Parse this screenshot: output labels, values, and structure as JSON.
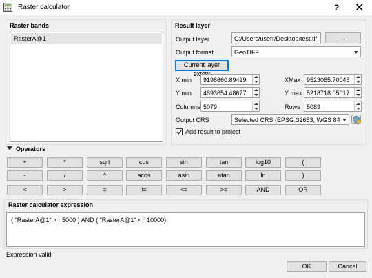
{
  "window": {
    "title": "Raster calculator",
    "help": "?",
    "close": "✕"
  },
  "raster_bands": {
    "title": "Raster bands",
    "items": [
      "RasterA@1"
    ]
  },
  "result_layer": {
    "title": "Result layer",
    "output_layer_label": "Output layer",
    "output_layer_value": "C:/Users/userr/Desktop/test.tif",
    "browse_label": "...",
    "output_format_label": "Output format",
    "output_format_value": "GeoTIFF",
    "current_extent_label": "Current layer extent",
    "xmin_label": "X min",
    "xmin_value": "9198660.89429",
    "xmax_label": "XMax",
    "xmax_value": "9523085.70045",
    "ymin_label": "Y min",
    "ymin_value": "4893654.48677",
    "ymax_label": "Y max",
    "ymax_value": "5218718.05017",
    "columns_label": "Columns",
    "columns_value": "5079",
    "rows_label": "Rows",
    "rows_value": "5089",
    "crs_label": "Output CRS",
    "crs_value": "Selected CRS (EPSG:32653, WGS 84 / UTM",
    "add_result_label": "Add result to project",
    "add_result_checked": true
  },
  "operators": {
    "title": "Operators",
    "rows": [
      [
        "+",
        "*",
        "sqrt",
        "cos",
        "sin",
        "tan",
        "log10",
        "("
      ],
      [
        "-",
        "/",
        "^",
        "acos",
        "asin",
        "atan",
        "ln",
        ")"
      ],
      [
        "<",
        ">",
        "=",
        "!=",
        "<=",
        ">=",
        "AND",
        "OR"
      ]
    ]
  },
  "expression": {
    "title": "Raster calculator expression",
    "value": "( \"RasterA@1\" >= 5000 )  AND  ( \"RasterA@1\" <= 10000)",
    "status": "Expression valid"
  },
  "footer": {
    "ok_label": "OK",
    "cancel_label": "Cancel"
  },
  "colors": {
    "accent": "#0078d7",
    "background": "#f0f0f0"
  }
}
